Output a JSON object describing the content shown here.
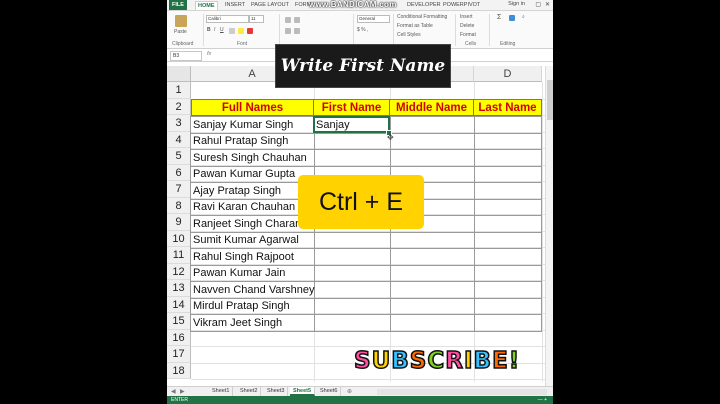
{
  "ribbon_tabs": [
    "FILE",
    "HOME",
    "INSERT",
    "PAGE LAYOUT",
    "FORM",
    "DEVELOPER",
    "POWERPIVOT"
  ],
  "sign_in": "Sign in",
  "watermark": "www.BANDICAM.com",
  "ribbon": {
    "font_name": "Calibri",
    "font_size": "11",
    "number_format": "General",
    "paste": "Paste",
    "conditional_formatting": "Conditional Formatting",
    "format_as_table": "Format as Table",
    "cell_styles": "Cell Styles",
    "insert": "Insert",
    "delete": "Delete",
    "format": "Format",
    "groups": [
      "Clipboard",
      "Font",
      "Cells",
      "Editing"
    ]
  },
  "formula_bar": {
    "name_box": "B3",
    "fx": "fx"
  },
  "columns": [
    "A",
    "B",
    "C",
    "D"
  ],
  "rows": [
    "1",
    "2",
    "3",
    "4",
    "5",
    "6",
    "7",
    "8",
    "9",
    "10",
    "11",
    "12",
    "13",
    "14",
    "15",
    "16",
    "17",
    "18"
  ],
  "headers": [
    "Full Names",
    "First Name",
    "Middle Name",
    "Last Name"
  ],
  "full_names": [
    "Sanjay Kumar Singh",
    "Rahul Pratap Singh",
    "Suresh Singh Chauhan",
    "Pawan Kumar Gupta",
    "Ajay Pratap Singh",
    "Ravi Karan Chauhan",
    "Ranjeet Singh Charan",
    "Sumit Kumar Agarwal",
    "Rahul Singh Rajpoot",
    "Pawan Kumar Jain",
    "Navven Chand Varshney",
    "Mirdul Pratap Singh",
    "Vikram Jeet Singh"
  ],
  "first_name_entry": "Sanjay",
  "overlays": {
    "title": "Write First Name",
    "shortcut": "Ctrl + E",
    "subscribe": "SUBSCRIBE!"
  },
  "sheets": [
    "Sheet1",
    "Sheet2",
    "Sheet3",
    "Sheet5",
    "Sheet6"
  ],
  "active_sheet": "Sheet5",
  "status": "ENTER",
  "colors": {
    "header_fill": "#ffff00",
    "header_text": "#d40000",
    "excel_green": "#217346",
    "shortcut_fill": "#ffd200"
  }
}
